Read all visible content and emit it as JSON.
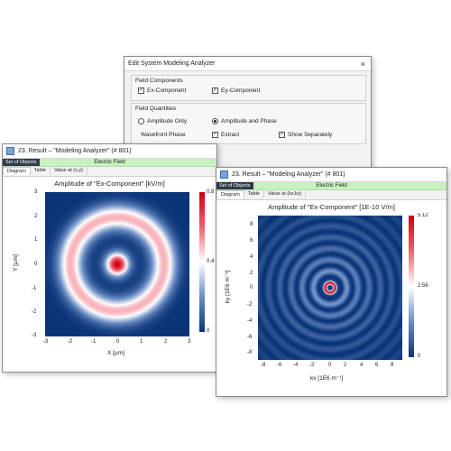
{
  "dialog": {
    "title": "Edit System Modeling Analyzer",
    "close": "×",
    "field_components": {
      "title": "Field Components",
      "ex_label": "Ex-Component",
      "ex_checked": true,
      "ey_label": "Ey-Component",
      "ey_checked": true
    },
    "field_quantities": {
      "title": "Field Quantities",
      "amp_only_label": "Amplitude Only",
      "amp_only_selected": false,
      "amp_phase_label": "Amplitude and Phase",
      "amp_phase_selected": true,
      "wavefront_label": "Wavefront Phase",
      "extract_label": "Extract",
      "extract_checked": true,
      "show_sep_label": "Show Separately",
      "show_sep_checked": true
    }
  },
  "win1": {
    "title": "23. Result – \"Modeling Analyzer\" (# 801)",
    "set_of_objects": "Set of Objects",
    "field_label": "Electric Field",
    "tabs": [
      "Diagram",
      "Table",
      "Value at (x,y)"
    ],
    "active_tab": 0,
    "chart_title": "Amplitude of \"Ex-Component\"  [kV/m]",
    "x_label": "X [µm]",
    "y_label": "Y [µm]",
    "x_ticks": [
      "-3",
      "-2",
      "-1",
      "0",
      "1",
      "2",
      "3"
    ],
    "y_ticks": [
      "3",
      "2",
      "1",
      "0",
      "-1",
      "-2",
      "-3"
    ],
    "cbar_ticks": [
      "0.8",
      "0.4",
      "0"
    ]
  },
  "win2": {
    "title": "23. Result – \"Modeling Analyzer\" (# 801)",
    "set_of_objects": "Set of Objects",
    "field_label": "Electric Field",
    "tabs": [
      "Diagram",
      "Table",
      "Value at (kx,ky)"
    ],
    "active_tab": 0,
    "chart_title": "Amplitude of \"Ex-Component\"  [1E-10 V/m]",
    "x_label": "kx [1E6 m⁻¹]",
    "y_label": "ky [1E6 m⁻¹]",
    "x_ticks": [
      "-8",
      "-6",
      "-4",
      "-2",
      "0",
      "2",
      "4",
      "6",
      "8"
    ],
    "y_ticks": [
      "8",
      "6",
      "4",
      "2",
      "0",
      "-2",
      "-4",
      "-6",
      "-8"
    ],
    "cbar_ticks": [
      "5.12",
      "2.56",
      "0"
    ]
  },
  "colors": {
    "hot": "#cc0010",
    "mid": "#ffffff",
    "cold": "#0a3478",
    "green_bar": "#c9f0bf"
  },
  "chart_data": [
    {
      "type": "heatmap",
      "title": "Amplitude of \"Ex-Component\"  [kV/m]",
      "xlabel": "X [µm]",
      "ylabel": "Y [µm]",
      "xlim": [
        -3,
        3
      ],
      "ylim": [
        -3,
        3
      ],
      "color_range": [
        0,
        0.8
      ],
      "colorbar_ticks": [
        0.8,
        0.4,
        0
      ],
      "pattern": "radial: central peak of amplitude ~0.8, single bright ring peaking near r = 2 µm, zero between and outside"
    },
    {
      "type": "heatmap",
      "title": "Amplitude of \"Ex-Component\"  [1E-10 V/m]",
      "xlabel": "kx [1E6 m⁻¹]",
      "ylabel": "ky [1E6 m⁻¹]",
      "xlim": [
        -9,
        9
      ],
      "ylim": [
        -9,
        9
      ],
      "color_range": [
        0,
        5.12
      ],
      "colorbar_ticks": [
        5.12,
        2.56,
        0
      ],
      "pattern": "radial: bright ring of amplitude ~5.12 near r = 0.6, surrounded by weak concentric rings decaying outward"
    }
  ]
}
